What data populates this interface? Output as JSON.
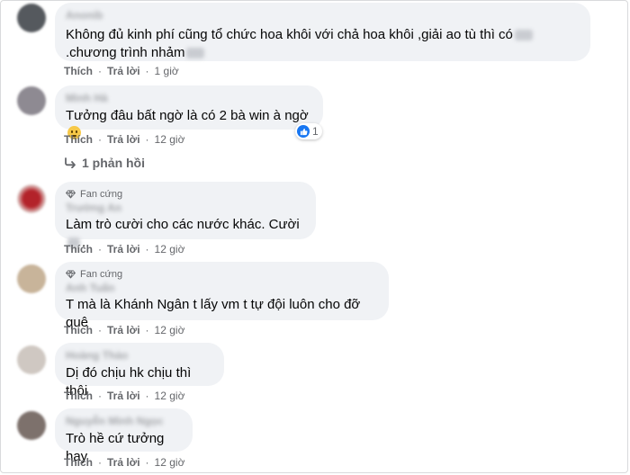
{
  "actions": {
    "like": "Thích",
    "reply": "Trả lời",
    "sep": "·"
  },
  "replies_label": "1 phản hồi",
  "comments": [
    {
      "avatar_color": "#55595e",
      "name": "Anonib",
      "text_part1": "Không đủ kinh phí cũng tổ chức hoa khôi với chả hoa khôi ,giải ao tù thì có",
      "text_part2": ".chương trình nhảm",
      "time": "1 giờ"
    },
    {
      "avatar_color": "#8e8a92",
      "name": "Minh Hà",
      "text": "Tưởng đâu bất ngờ là có 2 bà win à ngờ",
      "emoji": "grimacing-face",
      "time": "12 giờ",
      "reaction_count": "1"
    },
    {
      "avatar_color": "#b3232a",
      "badge": "Fan cứng",
      "name": "Trường An",
      "text": "Làm trò cười cho các nước khác. Cười",
      "text_tail": ".",
      "time": "12 giờ"
    },
    {
      "avatar_color": "#c8b49a",
      "badge": "Fan cứng",
      "name": "Anh Tuấn",
      "text": "T mà là Khánh Ngân t lấy vm t tự đội luôn cho đỡ quê",
      "time": "12 giờ"
    },
    {
      "avatar_color": "#cfc8c2",
      "name": "Hoàng Thảo",
      "text": "Dị đó chịu hk chịu thì thôi",
      "time": "12 giờ"
    },
    {
      "avatar_color": "#7d716c",
      "name": "Nguyễn Minh Ngọc",
      "text": "Trò hề cứ tưởng hay",
      "time": "12 giờ"
    }
  ]
}
